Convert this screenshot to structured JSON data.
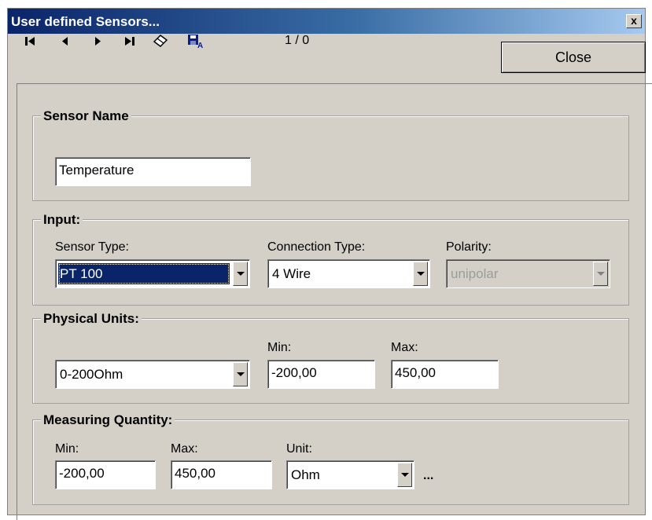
{
  "window": {
    "title": "User defined Sensors...",
    "close_glyph": "x"
  },
  "toolbar": {
    "icons": [
      "first-record-icon",
      "prev-record-icon",
      "next-record-icon",
      "last-record-icon",
      "eraser-icon",
      "save-as-icon"
    ],
    "record_counter": "1 / 0",
    "close_label": "Close"
  },
  "sensor_name": {
    "legend": "Sensor Name",
    "value": "Temperature"
  },
  "input": {
    "legend": "Input:",
    "sensor_type_label": "Sensor Type:",
    "sensor_type_value": "PT 100",
    "connection_type_label": "Connection Type:",
    "connection_type_value": "4 Wire",
    "polarity_label": "Polarity:",
    "polarity_value": "unipolar"
  },
  "physical_units": {
    "legend": "Physical Units:",
    "range_value": "0-200Ohm",
    "min_label": "Min:",
    "min_value": "-200,00",
    "max_label": "Max:",
    "max_value": "450,00"
  },
  "measuring_quantity": {
    "legend": "Measuring Quantity:",
    "min_label": "Min:",
    "min_value": "-200,00",
    "max_label": "Max:",
    "max_value": "450,00",
    "unit_label": "Unit:",
    "unit_value": "Ohm",
    "more_label": "..."
  }
}
